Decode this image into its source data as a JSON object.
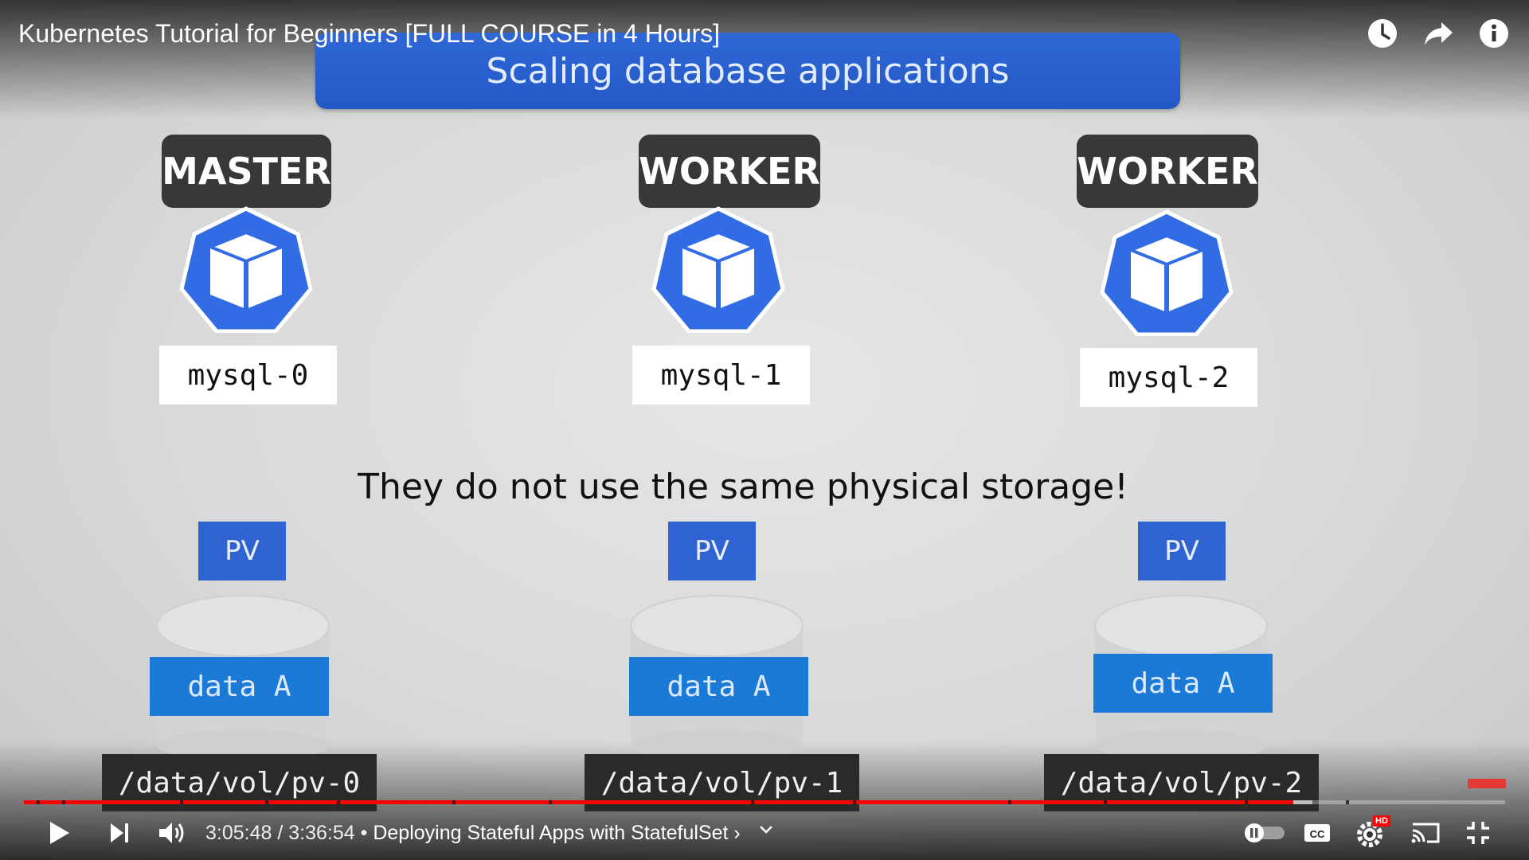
{
  "player": {
    "title": "Kubernetes Tutorial for Beginners [FULL COURSE in 4 Hours]",
    "current_time": "3:05:48",
    "separator": " / ",
    "duration": "3:36:54",
    "chapter_prefix": " • ",
    "chapter": "Deploying Stateful Apps with StatefulSet",
    "chapter_arrow": "›",
    "progress_fraction": 0.857,
    "buffer_fraction": 0.87,
    "hd_badge": "HD",
    "accent_color": "#ff0000"
  },
  "top_icons": [
    "watch-later-icon",
    "share-icon",
    "info-icon"
  ],
  "slide": {
    "title": "Scaling database applications",
    "message": "They do not use the same physical storage!",
    "nodes": [
      {
        "role": "MASTER",
        "pod": "mysql-0",
        "pv": "PV",
        "data": "data A",
        "path": "/data/vol/pv-0"
      },
      {
        "role": "WORKER",
        "pod": "mysql-1",
        "pv": "PV",
        "data": "data A",
        "path": "/data/vol/pv-1"
      },
      {
        "role": "WORKER",
        "pod": "mysql-2",
        "pv": "PV",
        "data": "data A",
        "path": "/data/vol/pv-2"
      }
    ],
    "colors": {
      "header": "#2f67d6",
      "pod": "#326ce5",
      "data": "#1a7ad6",
      "label": "#383838"
    }
  }
}
